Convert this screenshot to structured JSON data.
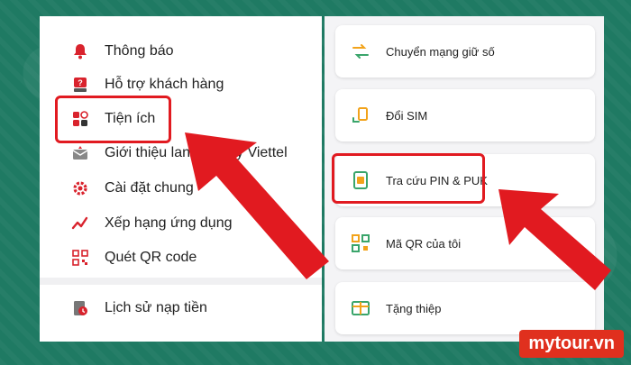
{
  "left_menu": {
    "items": [
      {
        "label": "Thông báo",
        "icon": "bell-icon"
      },
      {
        "label": "Hỗ trợ khách hàng",
        "icon": "help-chat-icon"
      },
      {
        "label": "Tiện ích",
        "icon": "utilities-grid-icon"
      },
      {
        "label": "Giới thiệu lan",
        "suffix": "y Viettel",
        "icon": "invite-envelope-icon"
      },
      {
        "label": "Cài đặt chung",
        "icon": "gear-icon"
      },
      {
        "label": "Xếp hạng ứng dụng",
        "icon": "rating-arrow-icon"
      },
      {
        "label": "Quét QR code",
        "icon": "qr-code-icon"
      }
    ],
    "history_label": "Lịch sử nạp tiền"
  },
  "right_cards": [
    {
      "label": "Chuyển mạng giữ số",
      "icon": "swap-arrows-icon"
    },
    {
      "label": "Đổi SIM",
      "icon": "sim-swap-icon"
    },
    {
      "label": "Tra cứu PIN & PUK",
      "icon": "sim-card-icon"
    },
    {
      "label": "Mã QR của tôi",
      "icon": "qr-code-icon"
    },
    {
      "label": "Tặng thiệp",
      "icon": "gift-card-icon"
    }
  ],
  "watermark": "mytour.vn",
  "colors": {
    "background": "#1f7a63",
    "highlight": "#e11a20",
    "accent_red": "#d9232d",
    "accent_orange": "#f2a31b"
  }
}
